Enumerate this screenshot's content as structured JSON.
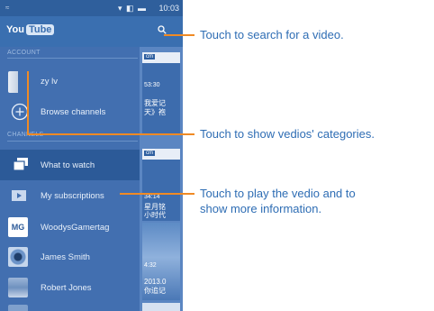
{
  "status_bar": {
    "time": "10:03",
    "icons": "▾ ◧ ▬"
  },
  "app_bar": {
    "logo_you": "You",
    "logo_tube": "Tube"
  },
  "drawer": {
    "account_label": "ACCOUNT",
    "account_name": "zy lv",
    "browse_label": "Browse channels",
    "channels_label": "CHANNELS",
    "items": [
      {
        "label": "What to watch"
      },
      {
        "label": "My subscriptions"
      },
      {
        "label": "WoodysGamertag"
      },
      {
        "label": "James Smith"
      },
      {
        "label": "Robert Jones"
      }
    ]
  },
  "feed": {
    "cards": [
      {
        "chip": "cm",
        "duration": "53:30",
        "caption_line1": "我爱记",
        "caption_line2": "天》袍"
      },
      {
        "chip": "cm",
        "duration": "34:14",
        "caption_line1": "星月铭",
        "caption_line2": "小时代"
      },
      {
        "chip": "",
        "duration": "4:32",
        "caption_line1": "2013.0",
        "caption_line2": "你追记"
      }
    ]
  },
  "callouts": {
    "search": "Touch to search for a video.",
    "categories": "Touch to show vedios' categories.",
    "play_line1": "Touch to play the vedio and to",
    "play_line2": "show more information."
  },
  "colors": {
    "accent": "#f08a24",
    "callout_text": "#2e6db4",
    "app_bg": "#3f74b3"
  }
}
